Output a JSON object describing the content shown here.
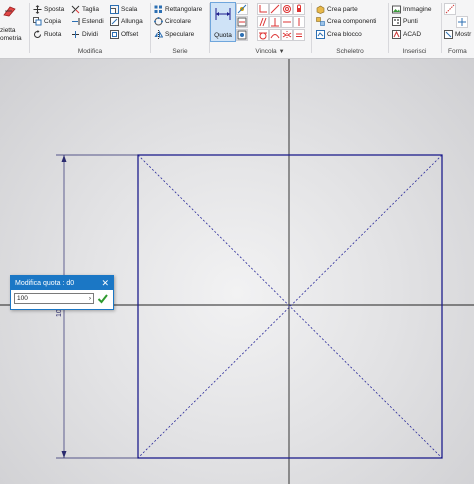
{
  "ribbon": {
    "sketch_button": {
      "label_line1": "zietta",
      "label_line2": "ometria"
    },
    "modifica": {
      "label": "Modifica",
      "items": [
        "Sposta",
        "Copia",
        "Ruota",
        "Taglia",
        "Estendi",
        "Dividi",
        "Scala",
        "Allunga",
        "Offset"
      ]
    },
    "serie": {
      "label": "Serie",
      "items": [
        "Rettangolare",
        "Circolare",
        "Speculare"
      ]
    },
    "quota": {
      "label": "Quota"
    },
    "vincola": {
      "label": "Vincola",
      "caret": "▼"
    },
    "scheletro": {
      "label": "Scheletro",
      "items": [
        "Crea parte",
        "Crea componenti",
        "Crea blocco"
      ]
    },
    "inserisci": {
      "label": "Inserisci",
      "items": [
        "Immagine",
        "Punti",
        "ACAD"
      ]
    },
    "formato": {
      "label": "Forma",
      "items": [
        "Mostr"
      ]
    }
  },
  "dimension": {
    "value_text": "100"
  },
  "dialog": {
    "title": "Modifica quota : d0",
    "close": "✕",
    "input_value": "100",
    "input_arrow": "›"
  },
  "colors": {
    "sketch_line": "#1e1e8c",
    "axis_line": "#222222",
    "accent": "#1b77c5",
    "ok_green": "#2f9a2f"
  }
}
